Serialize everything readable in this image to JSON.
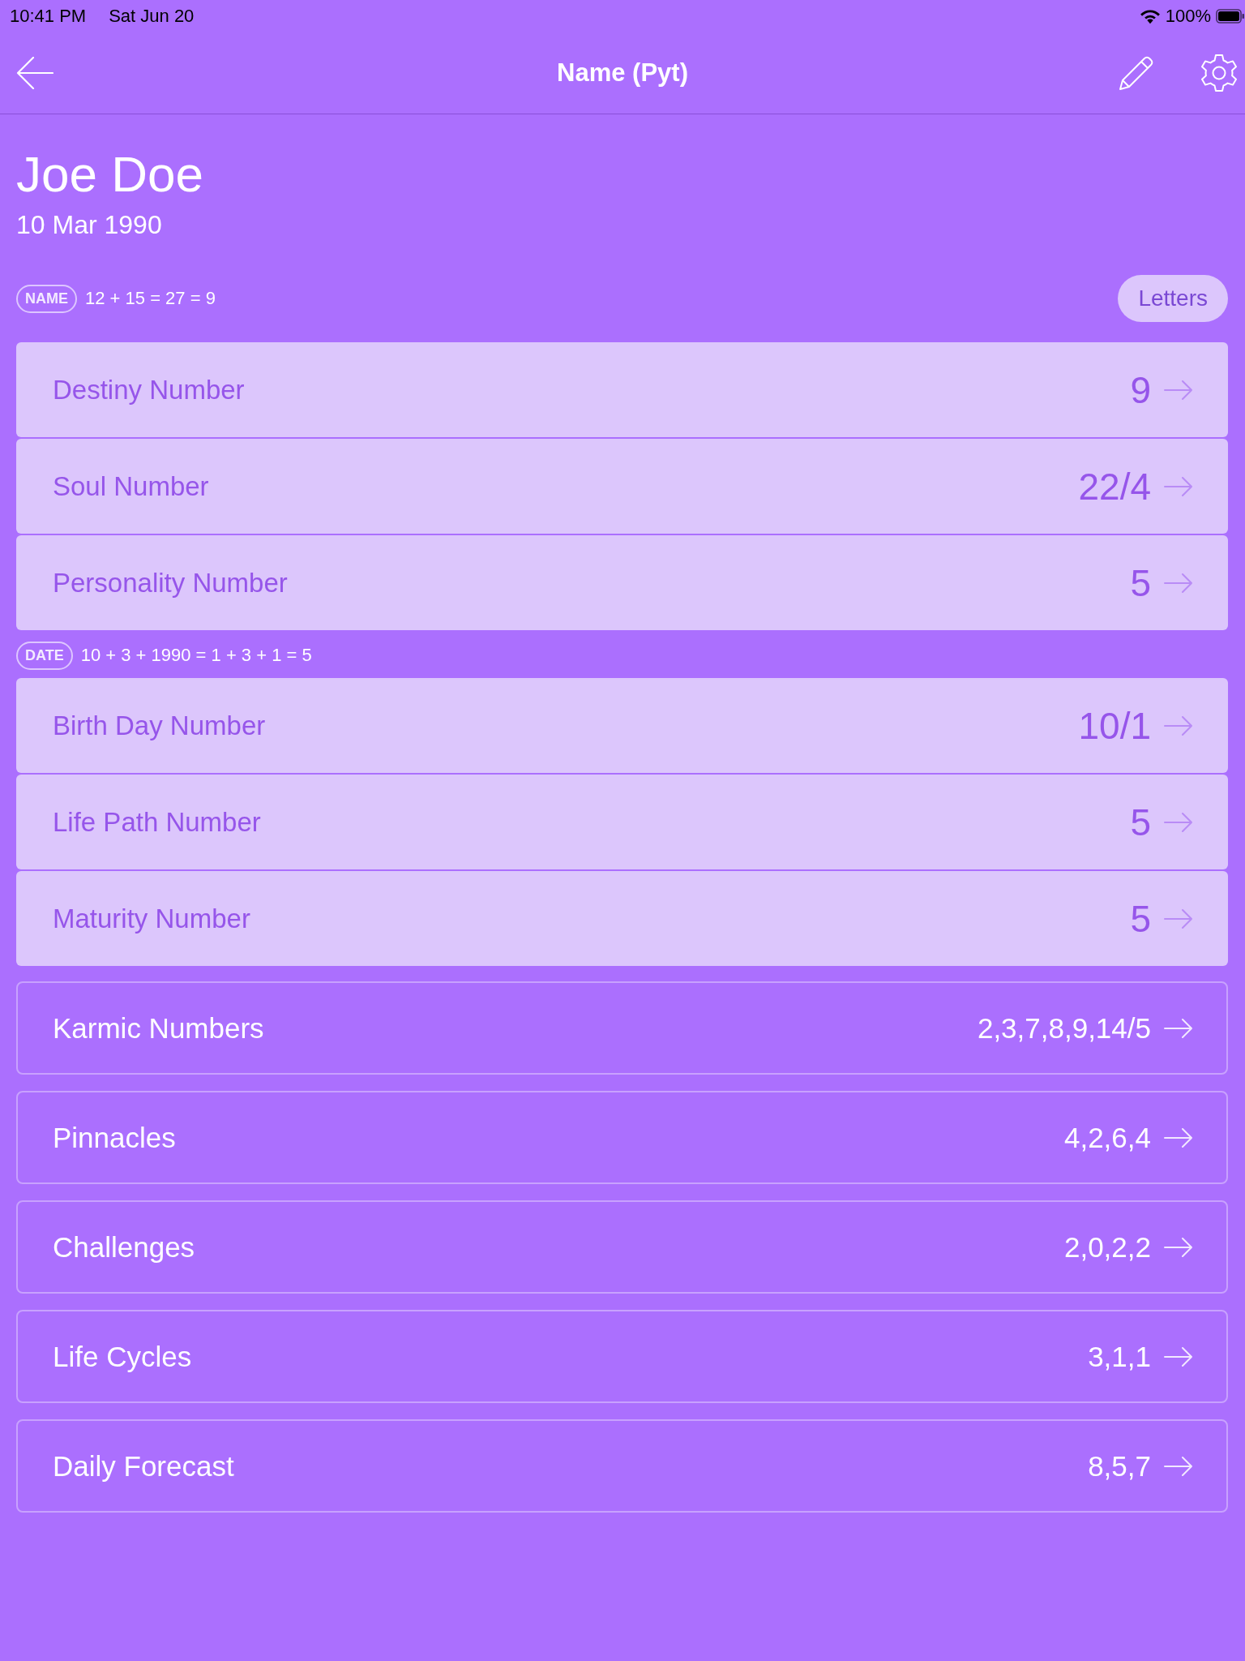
{
  "status_bar": {
    "time": "10:41 PM",
    "date": "Sat Jun 20",
    "battery": "100%"
  },
  "nav_bar": {
    "title": "Name (Pyt)"
  },
  "profile": {
    "name": "Joe Doe",
    "birth_date": "10 Mar 1990"
  },
  "sections": [
    {
      "badge": "NAME",
      "formula": "12 + 15 = 27 = 9",
      "button": "Letters",
      "cards": [
        {
          "label": "Destiny Number",
          "value": "9"
        },
        {
          "label": "Soul Number",
          "value": "22/4"
        },
        {
          "label": "Personality Number",
          "value": "5"
        }
      ]
    },
    {
      "badge": "DATE",
      "formula": "10 + 3 + 1990 = 1 + 3 + 1 = 5",
      "cards": [
        {
          "label": "Birth Day Number",
          "value": "10/1"
        },
        {
          "label": "Life Path Number",
          "value": "5"
        },
        {
          "label": "Maturity Number",
          "value": "5"
        }
      ]
    }
  ],
  "detail_rows": [
    {
      "label": "Karmic Numbers",
      "value": "2,3,7,8,9,14/5"
    },
    {
      "label": "Pinnacles",
      "value": "4,2,6,4"
    },
    {
      "label": "Challenges",
      "value": "2,0,2,2"
    },
    {
      "label": "Life Cycles",
      "value": "3,1,1"
    },
    {
      "label": "Daily Forecast",
      "value": "8,5,7"
    }
  ]
}
